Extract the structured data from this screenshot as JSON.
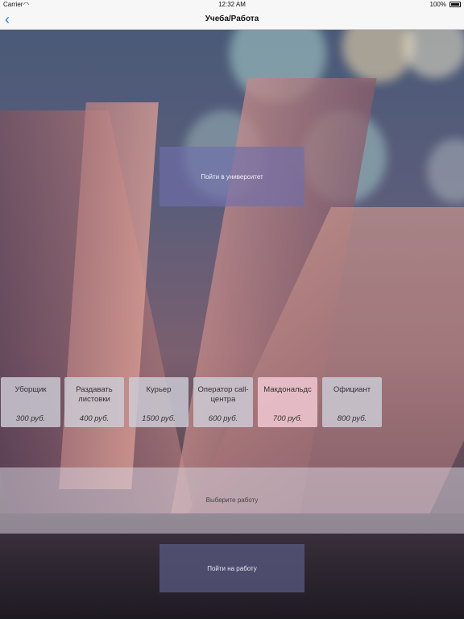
{
  "status_bar": {
    "carrier": "Carrier",
    "wifi_icon": "wifi-icon",
    "time": "12:32 AM",
    "battery": "100%"
  },
  "nav": {
    "back_icon": "chevron-left-icon",
    "back_glyph": "‹",
    "title": "Учеба/Работа"
  },
  "university_button": "Пойти в университет",
  "jobs": [
    {
      "name": "Уборщик",
      "price": "300 руб."
    },
    {
      "name": "Раздавать листовки",
      "price": "400 руб."
    },
    {
      "name": "Курьер",
      "price": "1500 руб."
    },
    {
      "name": "Оператор call-центра",
      "price": "600 руб."
    },
    {
      "name": "Макдональдс",
      "price": "700 руб."
    },
    {
      "name": "Официант",
      "price": "800 руб."
    }
  ],
  "choose_label": "Выберите работу",
  "work_button": "Пойти на работу",
  "colors": {
    "accent": "#1a7cf5",
    "nav_bg": "#f7f7f7"
  }
}
